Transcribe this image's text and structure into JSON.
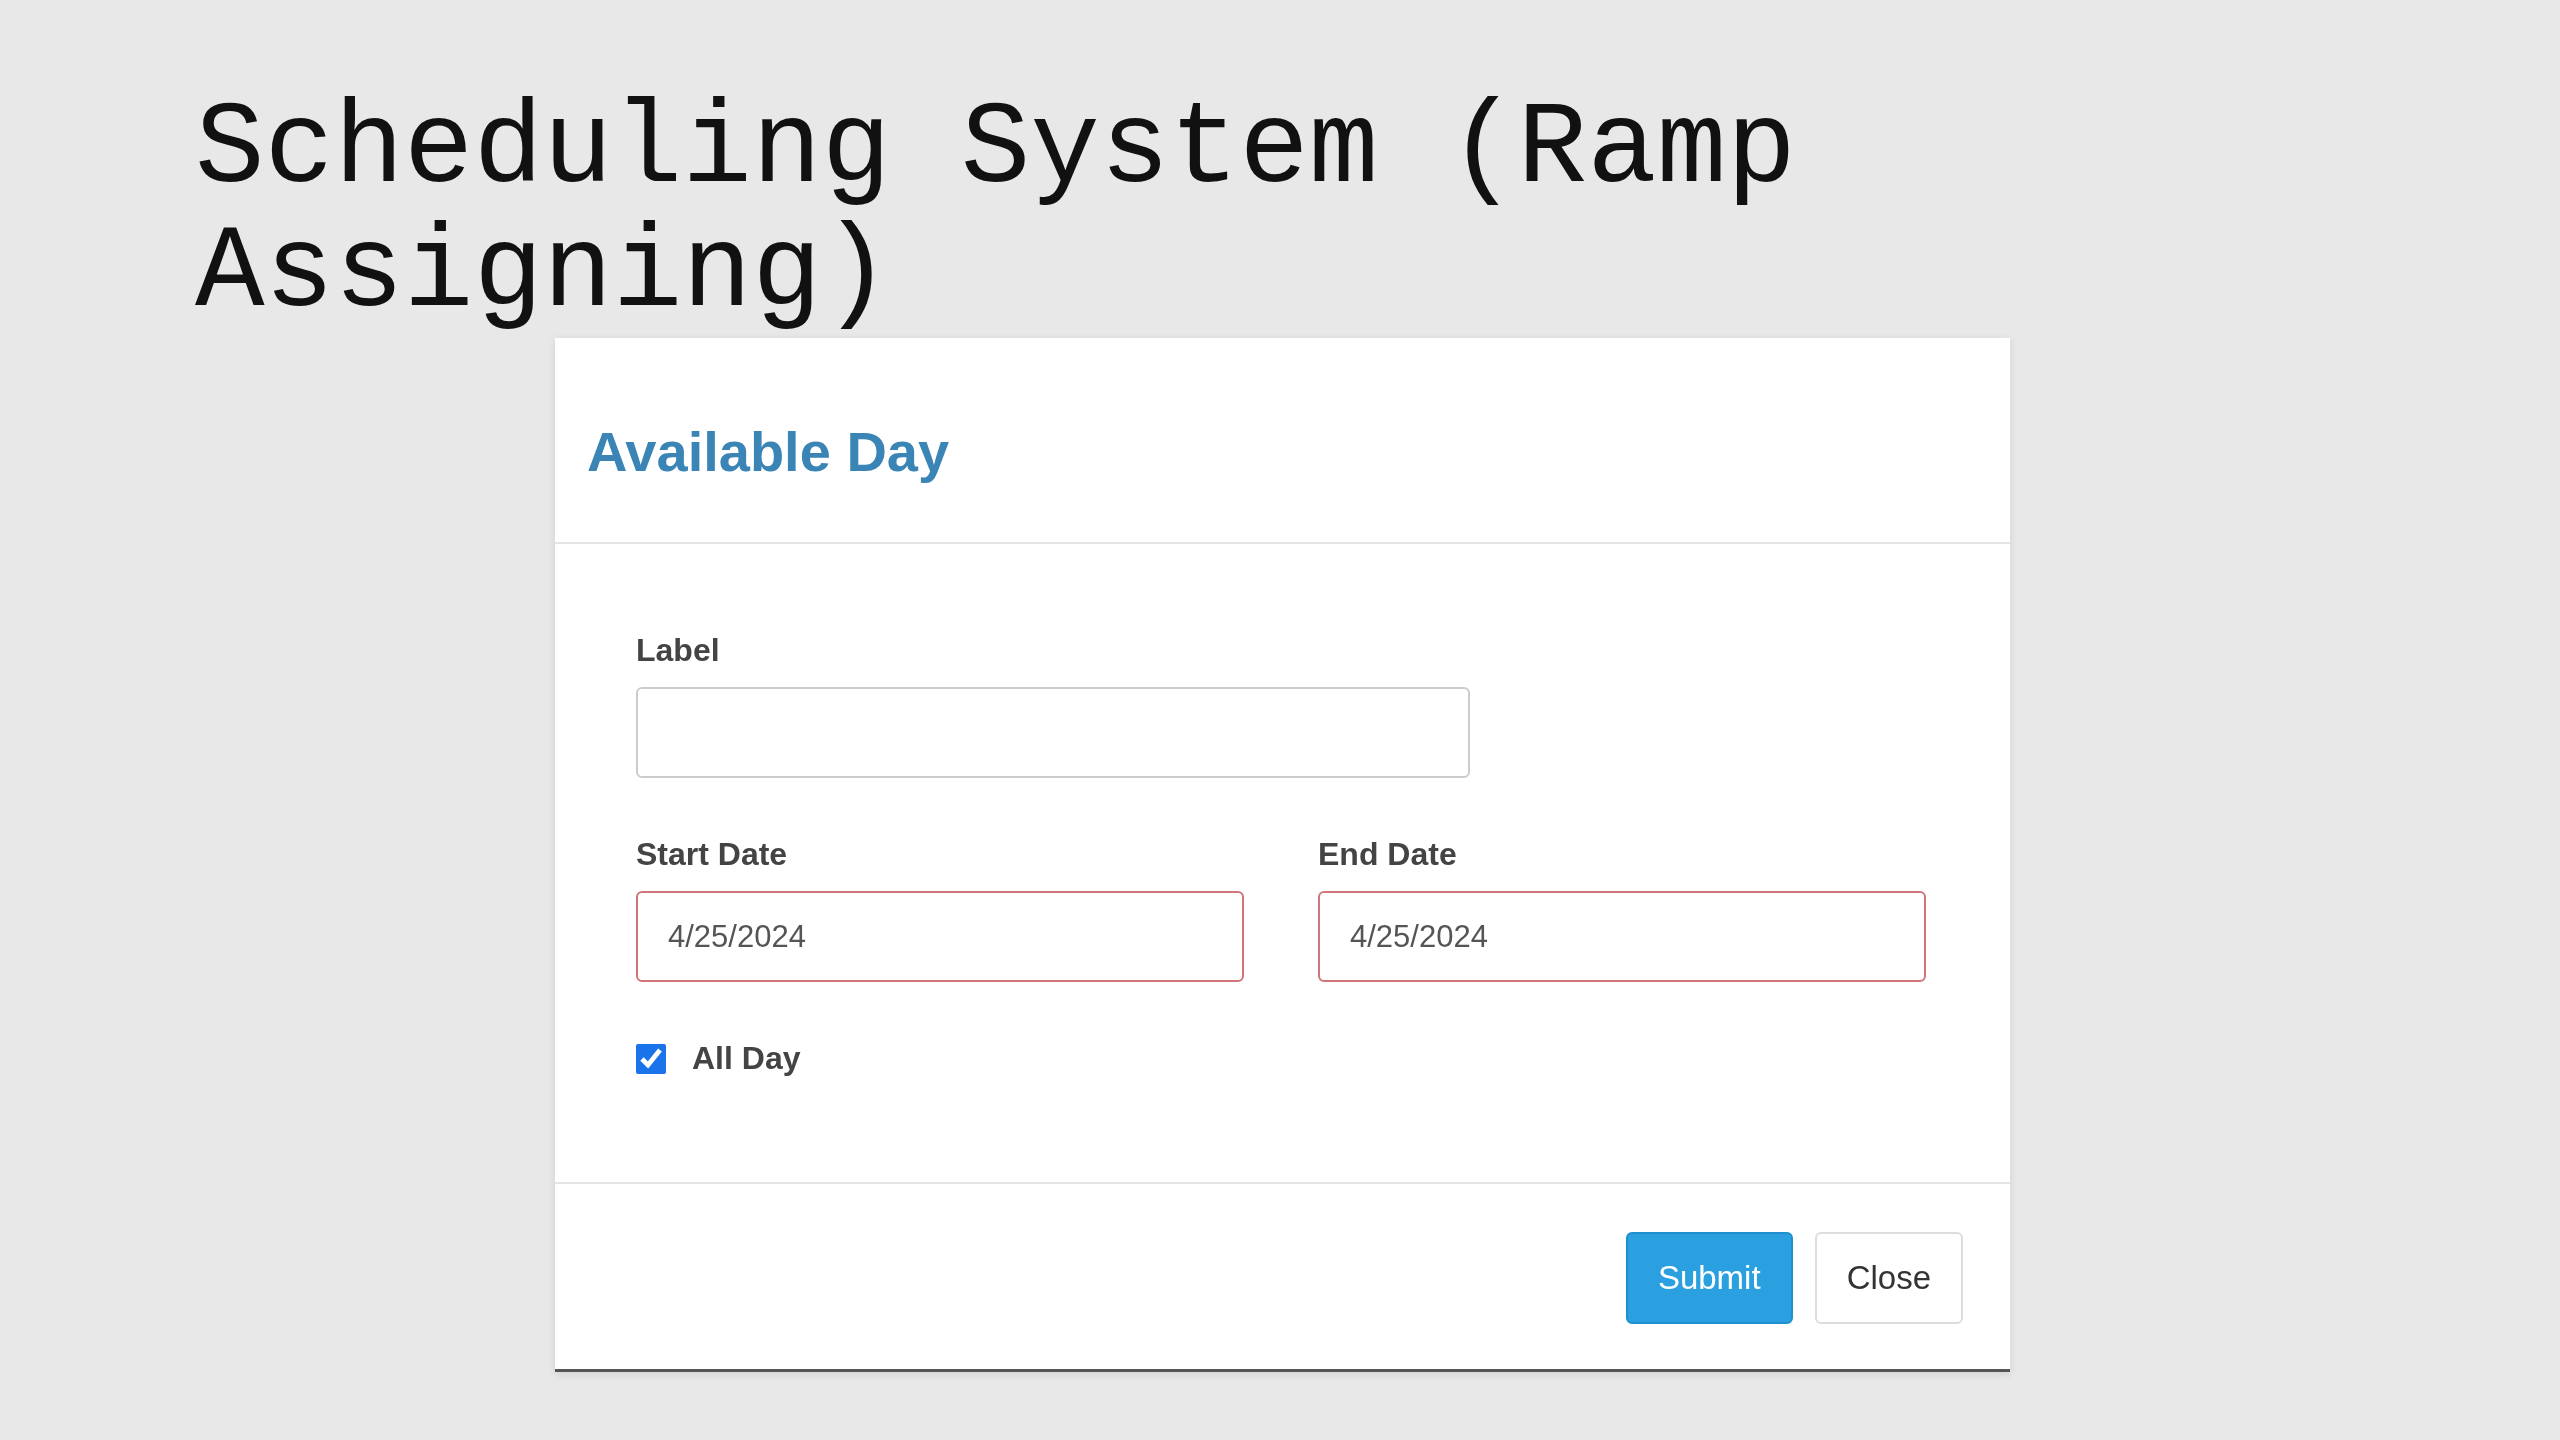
{
  "slide_title": "Scheduling System (Ramp Assigning)",
  "dialog": {
    "title": "Available Day",
    "fields": [
      {
        "label": "Label",
        "invalid": false
      },
      {
        "label": "Start Date",
        "value": "4/25/2024",
        "invalid": true
      },
      {
        "label": "End Date",
        "value": "4/25/2024",
        "invalid": true
      }
    ],
    "all_day": {
      "label": "All Day",
      "checked": true
    },
    "buttons": [
      {
        "label": "Submit",
        "kind": "primary"
      },
      {
        "label": "Close",
        "kind": "default"
      }
    ]
  }
}
